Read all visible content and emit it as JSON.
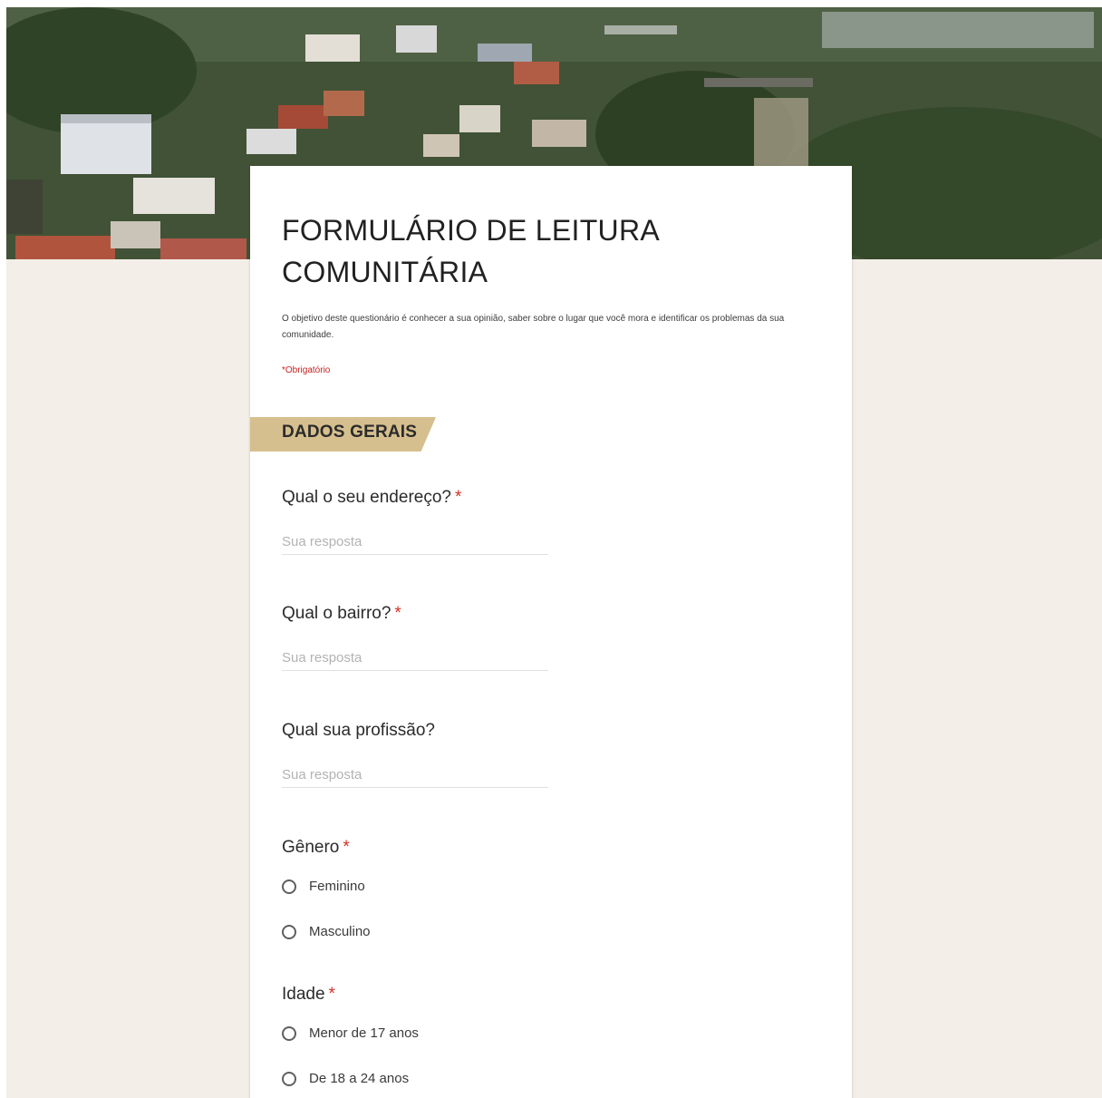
{
  "form": {
    "title": "FORMULÁRIO DE LEITURA COMUNITÁRIA",
    "description": "O objetivo deste questionário é conhecer a sua opinião, saber sobre o lugar que você mora e identificar os problemas da sua comunidade.",
    "required_note": "*Obrigatório"
  },
  "section": {
    "label": "DADOS GERAIS"
  },
  "questions": {
    "address": {
      "title": "Qual o seu endereço?",
      "required_mark": "*",
      "placeholder": "Sua resposta"
    },
    "neighborhood": {
      "title": "Qual o bairro?",
      "required_mark": "*",
      "placeholder": "Sua resposta"
    },
    "profession": {
      "title": "Qual sua profissão?",
      "placeholder": "Sua resposta"
    },
    "gender": {
      "title": "Gênero",
      "required_mark": "*",
      "options": [
        "Feminino",
        "Masculino"
      ]
    },
    "age": {
      "title": "Idade",
      "required_mark": "*",
      "options": [
        "Menor de 17 anos",
        "De 18 a 24 anos"
      ]
    }
  },
  "colors": {
    "page_background": "#f3efe8",
    "section_banner": "#d6bf8f",
    "required": "#d93025"
  }
}
